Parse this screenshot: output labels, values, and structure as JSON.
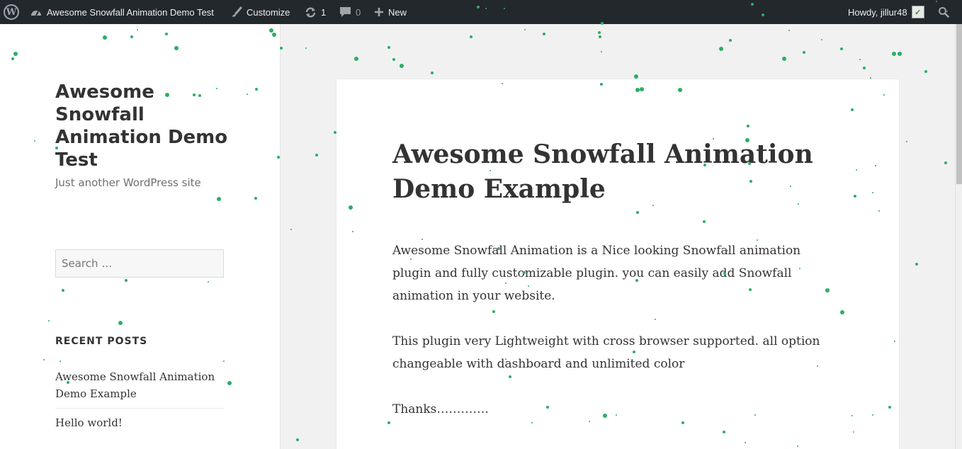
{
  "adminbar": {
    "site_name": "Awesome Snowfall Animation Demo Test",
    "customize": "Customize",
    "updates_count": "1",
    "comments_count": "0",
    "new_label": "New",
    "howdy": "Howdy, jillur48"
  },
  "sidebar": {
    "site_title": "Awesome Snowfall Animation Demo Test",
    "site_description": "Just another WordPress site",
    "search_placeholder": "Search …",
    "recent_posts_title": "RECENT POSTS",
    "recent_posts": [
      "Awesome Snowfall Animation Demo Example",
      "Hello world!"
    ]
  },
  "article": {
    "title": "Awesome Snowfall Animation Demo Example",
    "paragraphs": [
      "Awesome Snowfall Animation is a Nice looking Snowfall animation plugin and fully customizable plugin. you can easily add Snowfall animation in your website.",
      "This plugin very Lightweight with cross browser supported. all option changeable with dashboard and unlimited color",
      "Thanks…………."
    ]
  },
  "colors": {
    "adminbar_bg": "#23282d",
    "snow": "#2bae66",
    "page_bg": "#f1f1f1"
  }
}
